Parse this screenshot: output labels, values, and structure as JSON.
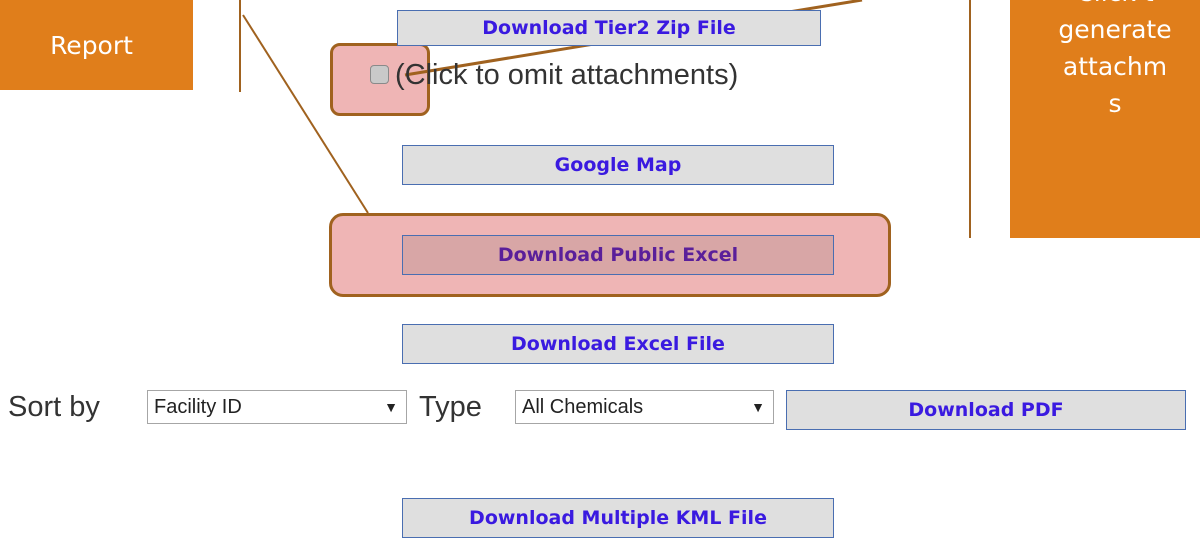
{
  "callouts": {
    "left_text": "Report",
    "right_lines": [
      "Click t",
      "generate",
      "attachm",
      "s"
    ]
  },
  "buttons": {
    "tier2_zip": "Download Tier2 Zip File",
    "google_map": "Google Map",
    "public_excel": "Download Public Excel",
    "excel_file": "Download Excel File",
    "pdf": "Download PDF",
    "kml": "Download Multiple KML File"
  },
  "omit_attachments": {
    "label": "(Click to omit attachments)",
    "checked": false
  },
  "sort": {
    "label": "Sort by",
    "selected": "Facility ID"
  },
  "type": {
    "label": "Type",
    "selected": "All Chemicals"
  },
  "colors": {
    "callout": "#e07e1b",
    "highlight": "#e89090",
    "button_bg": "#dfdfdf",
    "button_text": "#3a1ae0"
  }
}
